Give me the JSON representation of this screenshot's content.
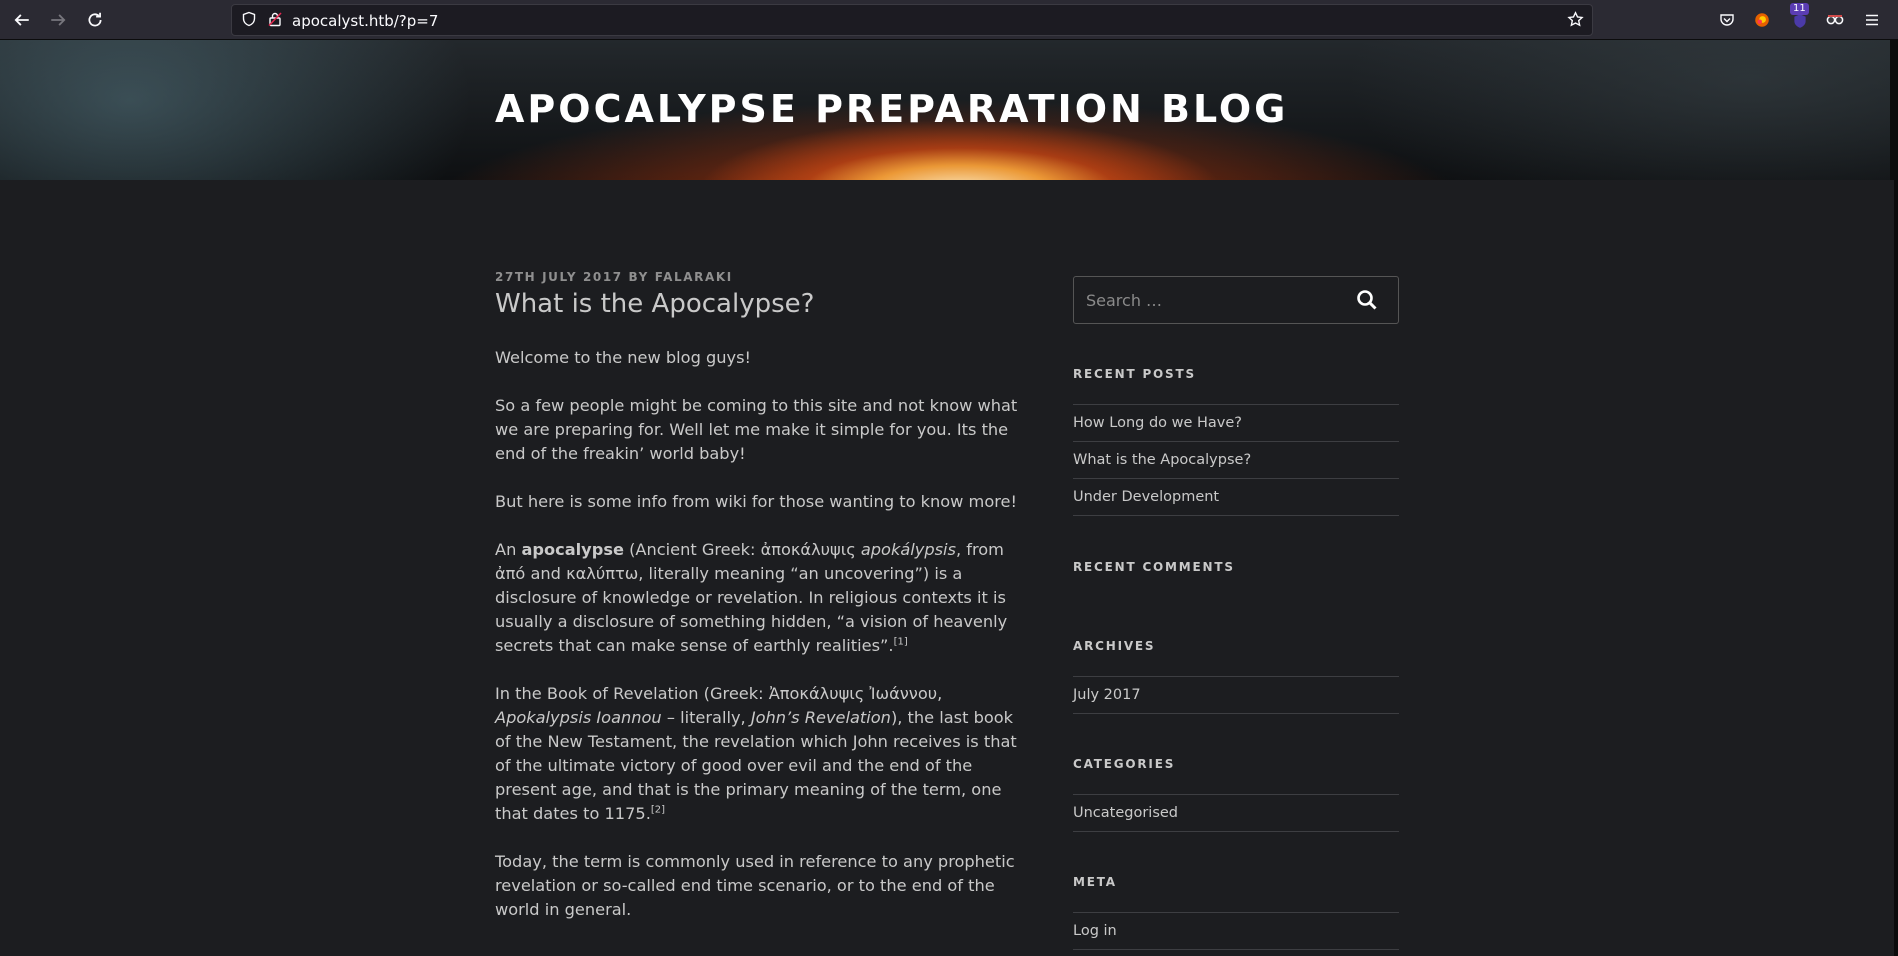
{
  "browser": {
    "url": "apocalyst.htb/?p=7",
    "extension_badge": "11"
  },
  "site": {
    "title": "APOCALYPSE PREPARATION BLOG"
  },
  "post": {
    "date": "27TH JULY 2017",
    "by": "BY",
    "author": "FALARAKI",
    "title": "What is the Apocalypse?",
    "p1": "Welcome to the new blog guys!",
    "p2": "So a few people might be coming to this site and not know what we are preparing for. Well let me make it simple for you. Its the end of the freakin’ world baby!",
    "p3": "But here is some info from wiki for those wanting to know more!",
    "p4_a": "An ",
    "p4_bold": "apocalypse",
    "p4_b": " (Ancient Greek: ἀποκάλυψις ",
    "p4_italic": "apokálypsis",
    "p4_c": ", from ἀπό and καλύπτω, literally meaning “an uncovering”) is a disclosure of knowledge or revelation. In religious contexts it is usually a disclosure of something hidden, “a vision of heavenly secrets that can make sense of earthly realities”.",
    "p4_ref": "[1]",
    "p5_a": "In the Book of Revelation (Greek: Ἀποκάλυψις Ἰωάννου, ",
    "p5_italic1": "Apokalypsis Ioannou",
    "p5_b": " – literally, ",
    "p5_italic2": "John’s Revelation",
    "p5_c": "), the last book of the New Testament, the revelation which John receives is that of the ultimate victory of good over evil and the end of the present age, and that is the primary meaning of the term, one that dates to 1175.",
    "p5_ref": "[2]",
    "p6": "Today, the term is commonly used in reference to any prophetic revelation or so-called end time scenario, or to the end of the world in general."
  },
  "sidebar": {
    "search_placeholder": "Search …",
    "recent_posts_title": "RECENT POSTS",
    "recent_posts": [
      "How Long do we Have?",
      "What is the Apocalypse?",
      "Under Development"
    ],
    "recent_comments_title": "RECENT COMMENTS",
    "archives_title": "ARCHIVES",
    "archives": [
      "July 2017"
    ],
    "categories_title": "CATEGORIES",
    "categories": [
      "Uncategorised"
    ],
    "meta_title": "META",
    "meta": [
      "Log in"
    ]
  }
}
